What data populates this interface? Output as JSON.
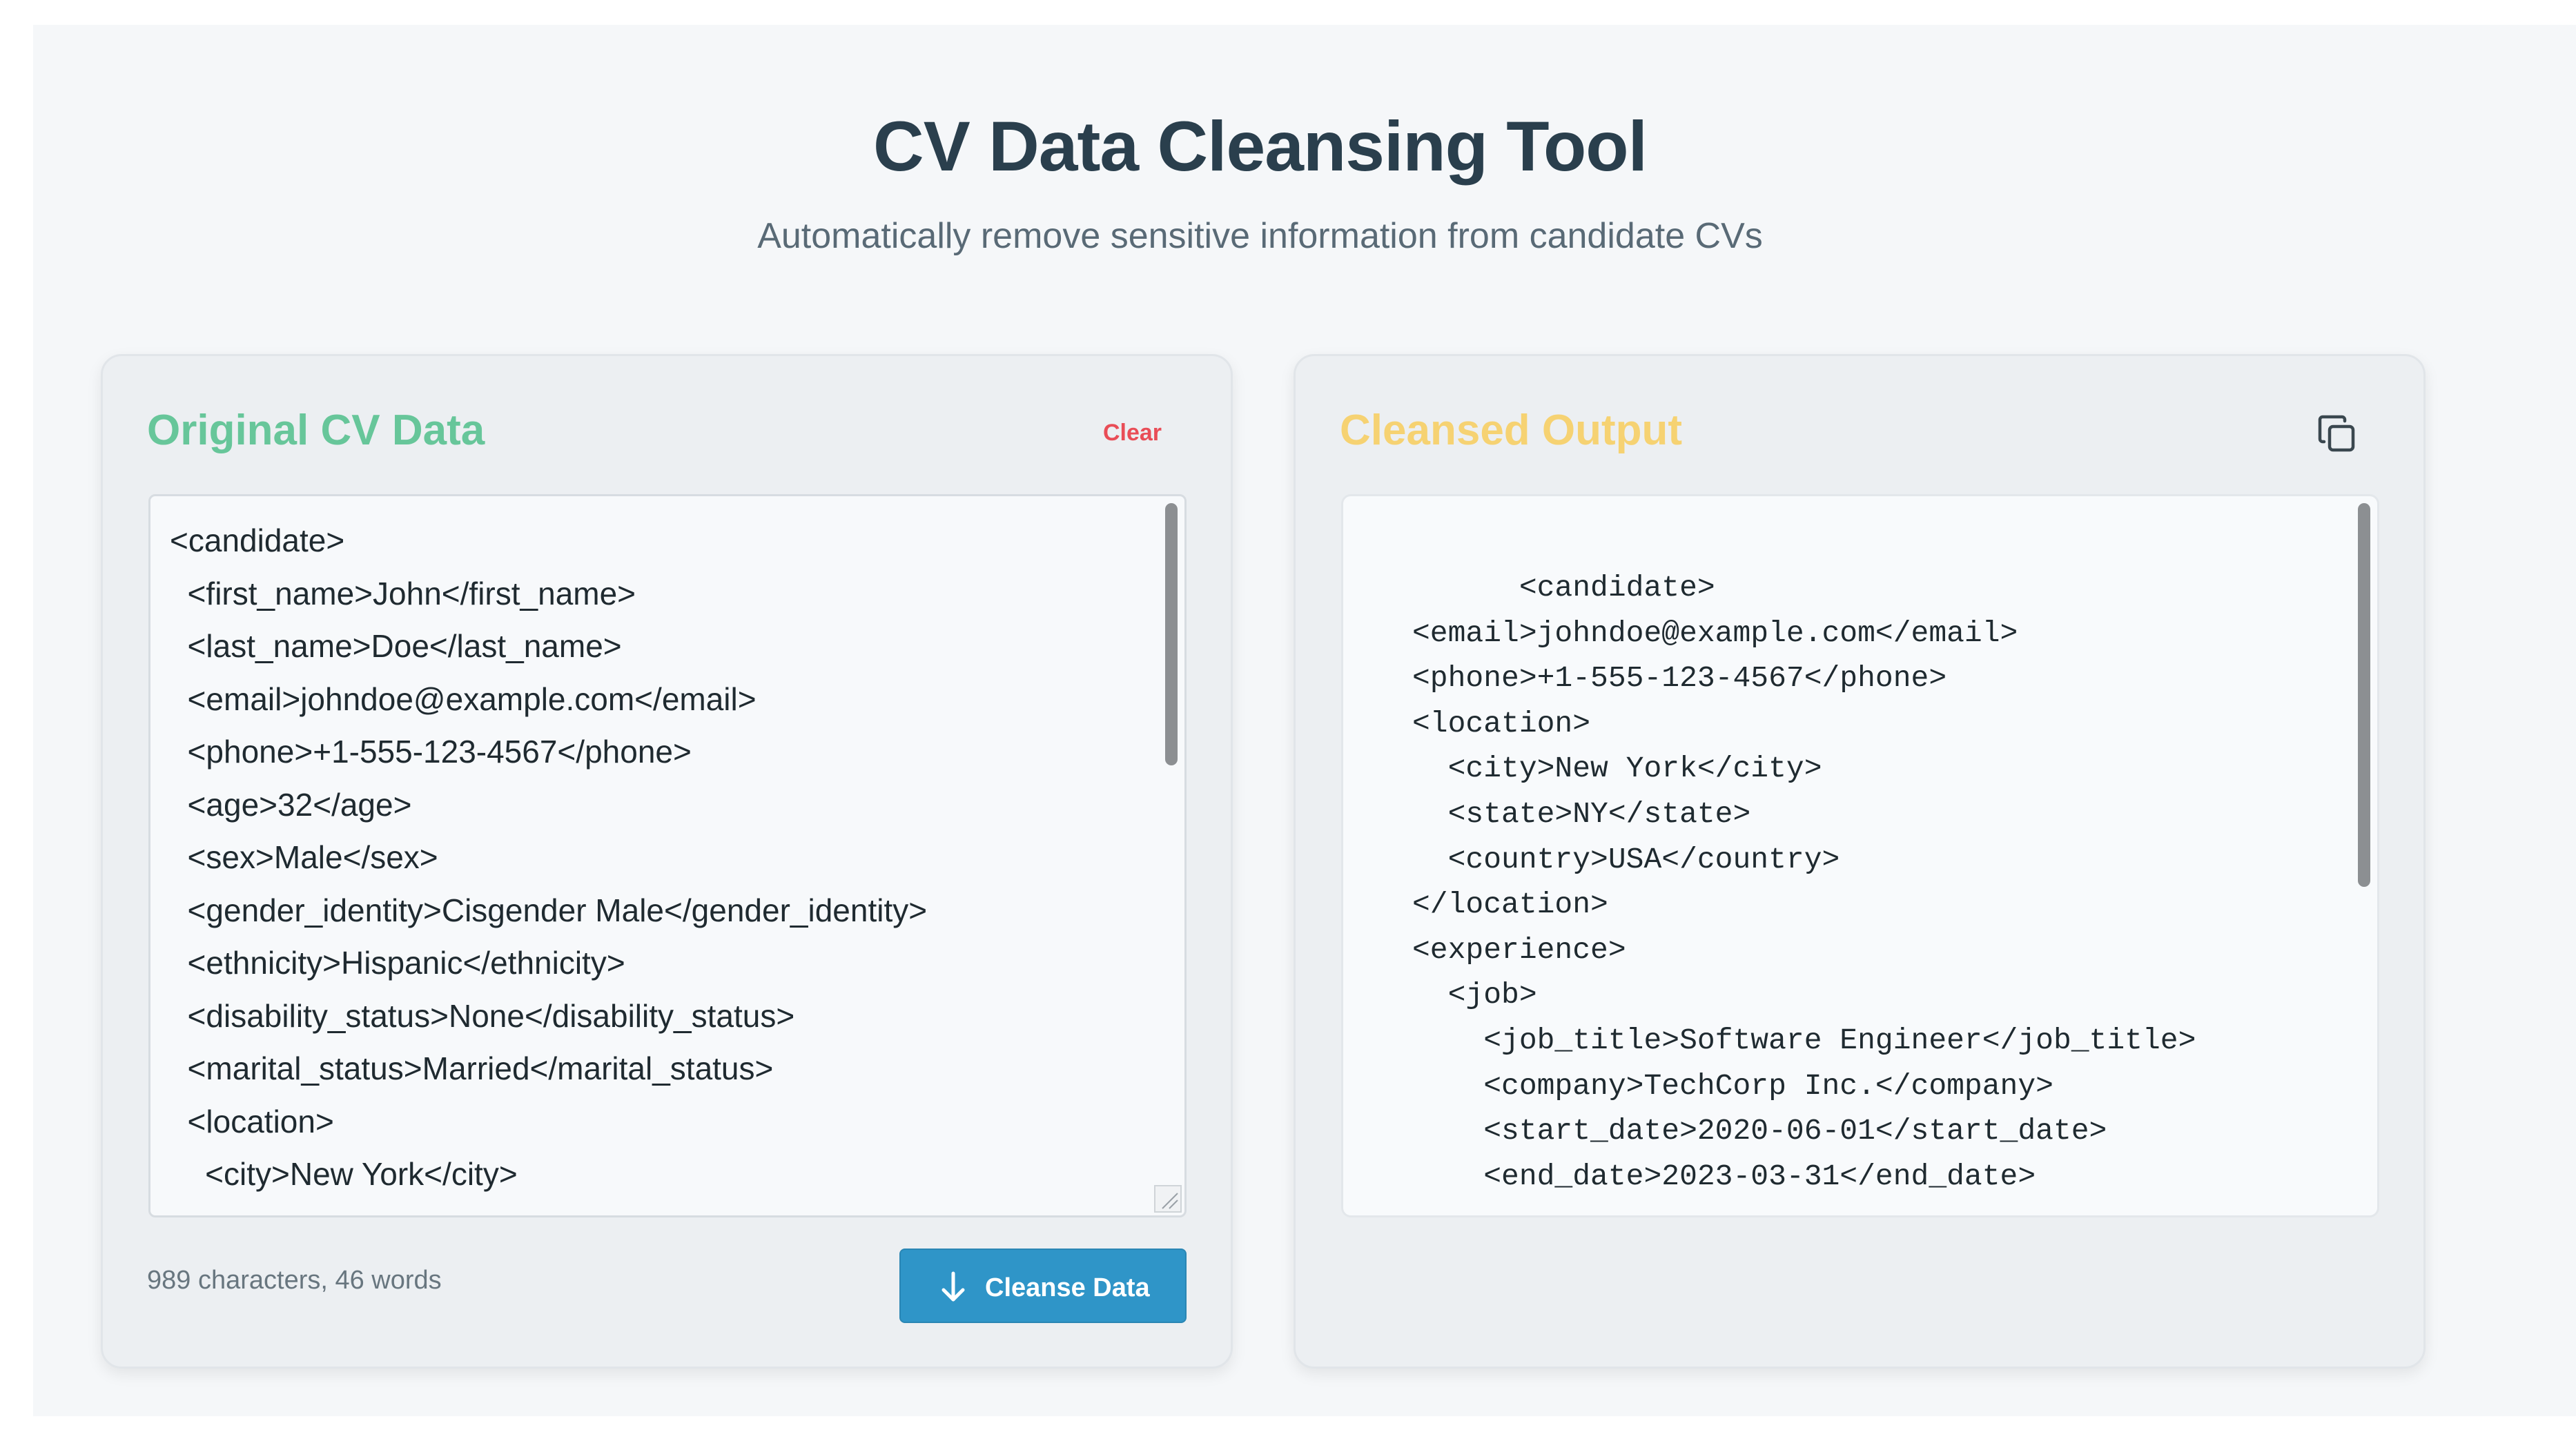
{
  "header": {
    "title": "CV Data Cleansing Tool",
    "subtitle": "Automatically remove sensitive information from candidate CVs"
  },
  "input_panel": {
    "title": "Original CV Data",
    "clear_label": "Clear",
    "lines": [
      "<candidate>",
      "  <first_name>John</first_name>",
      "  <last_name>Doe</last_name>",
      "  <email>johndoe@example.com</email>",
      "  <phone>+1-555-123-4567</phone>",
      "  <age>32</age>",
      "  <sex>Male</sex>",
      "  <gender_identity>Cisgender Male</gender_identity>",
      "  <ethnicity>Hispanic</ethnicity>",
      "  <disability_status>None</disability_status>",
      "  <marital_status>Married</marital_status>",
      "  <location>",
      "    <city>New York</city>"
    ],
    "stats": "989 characters, 46 words",
    "action_label": "Cleanse Data",
    "action_icon": "arrow-down-icon"
  },
  "output_panel": {
    "title": "Cleansed Output",
    "copy_icon": "copy-icon",
    "lines": [
      "      <candidate>",
      "<email>johndoe@example.com</email>",
      "<phone>+1-555-123-4567</phone>",
      "<location>",
      "  <city>New York</city>",
      "  <state>NY</state>",
      "  <country>USA</country>",
      "</location>",
      "<experience>",
      "  <job>",
      "    <job_title>Software Engineer</job_title>",
      "    <company>TechCorp Inc.</company>",
      "    <start_date>2020-06-01</start_date>",
      "    <end_date>2023-03-31</end_date>"
    ]
  },
  "colors": {
    "input_title": "#67c69a",
    "output_title": "#f6d272",
    "clear": "#e94d57",
    "primary_button": "#2f95c8"
  }
}
